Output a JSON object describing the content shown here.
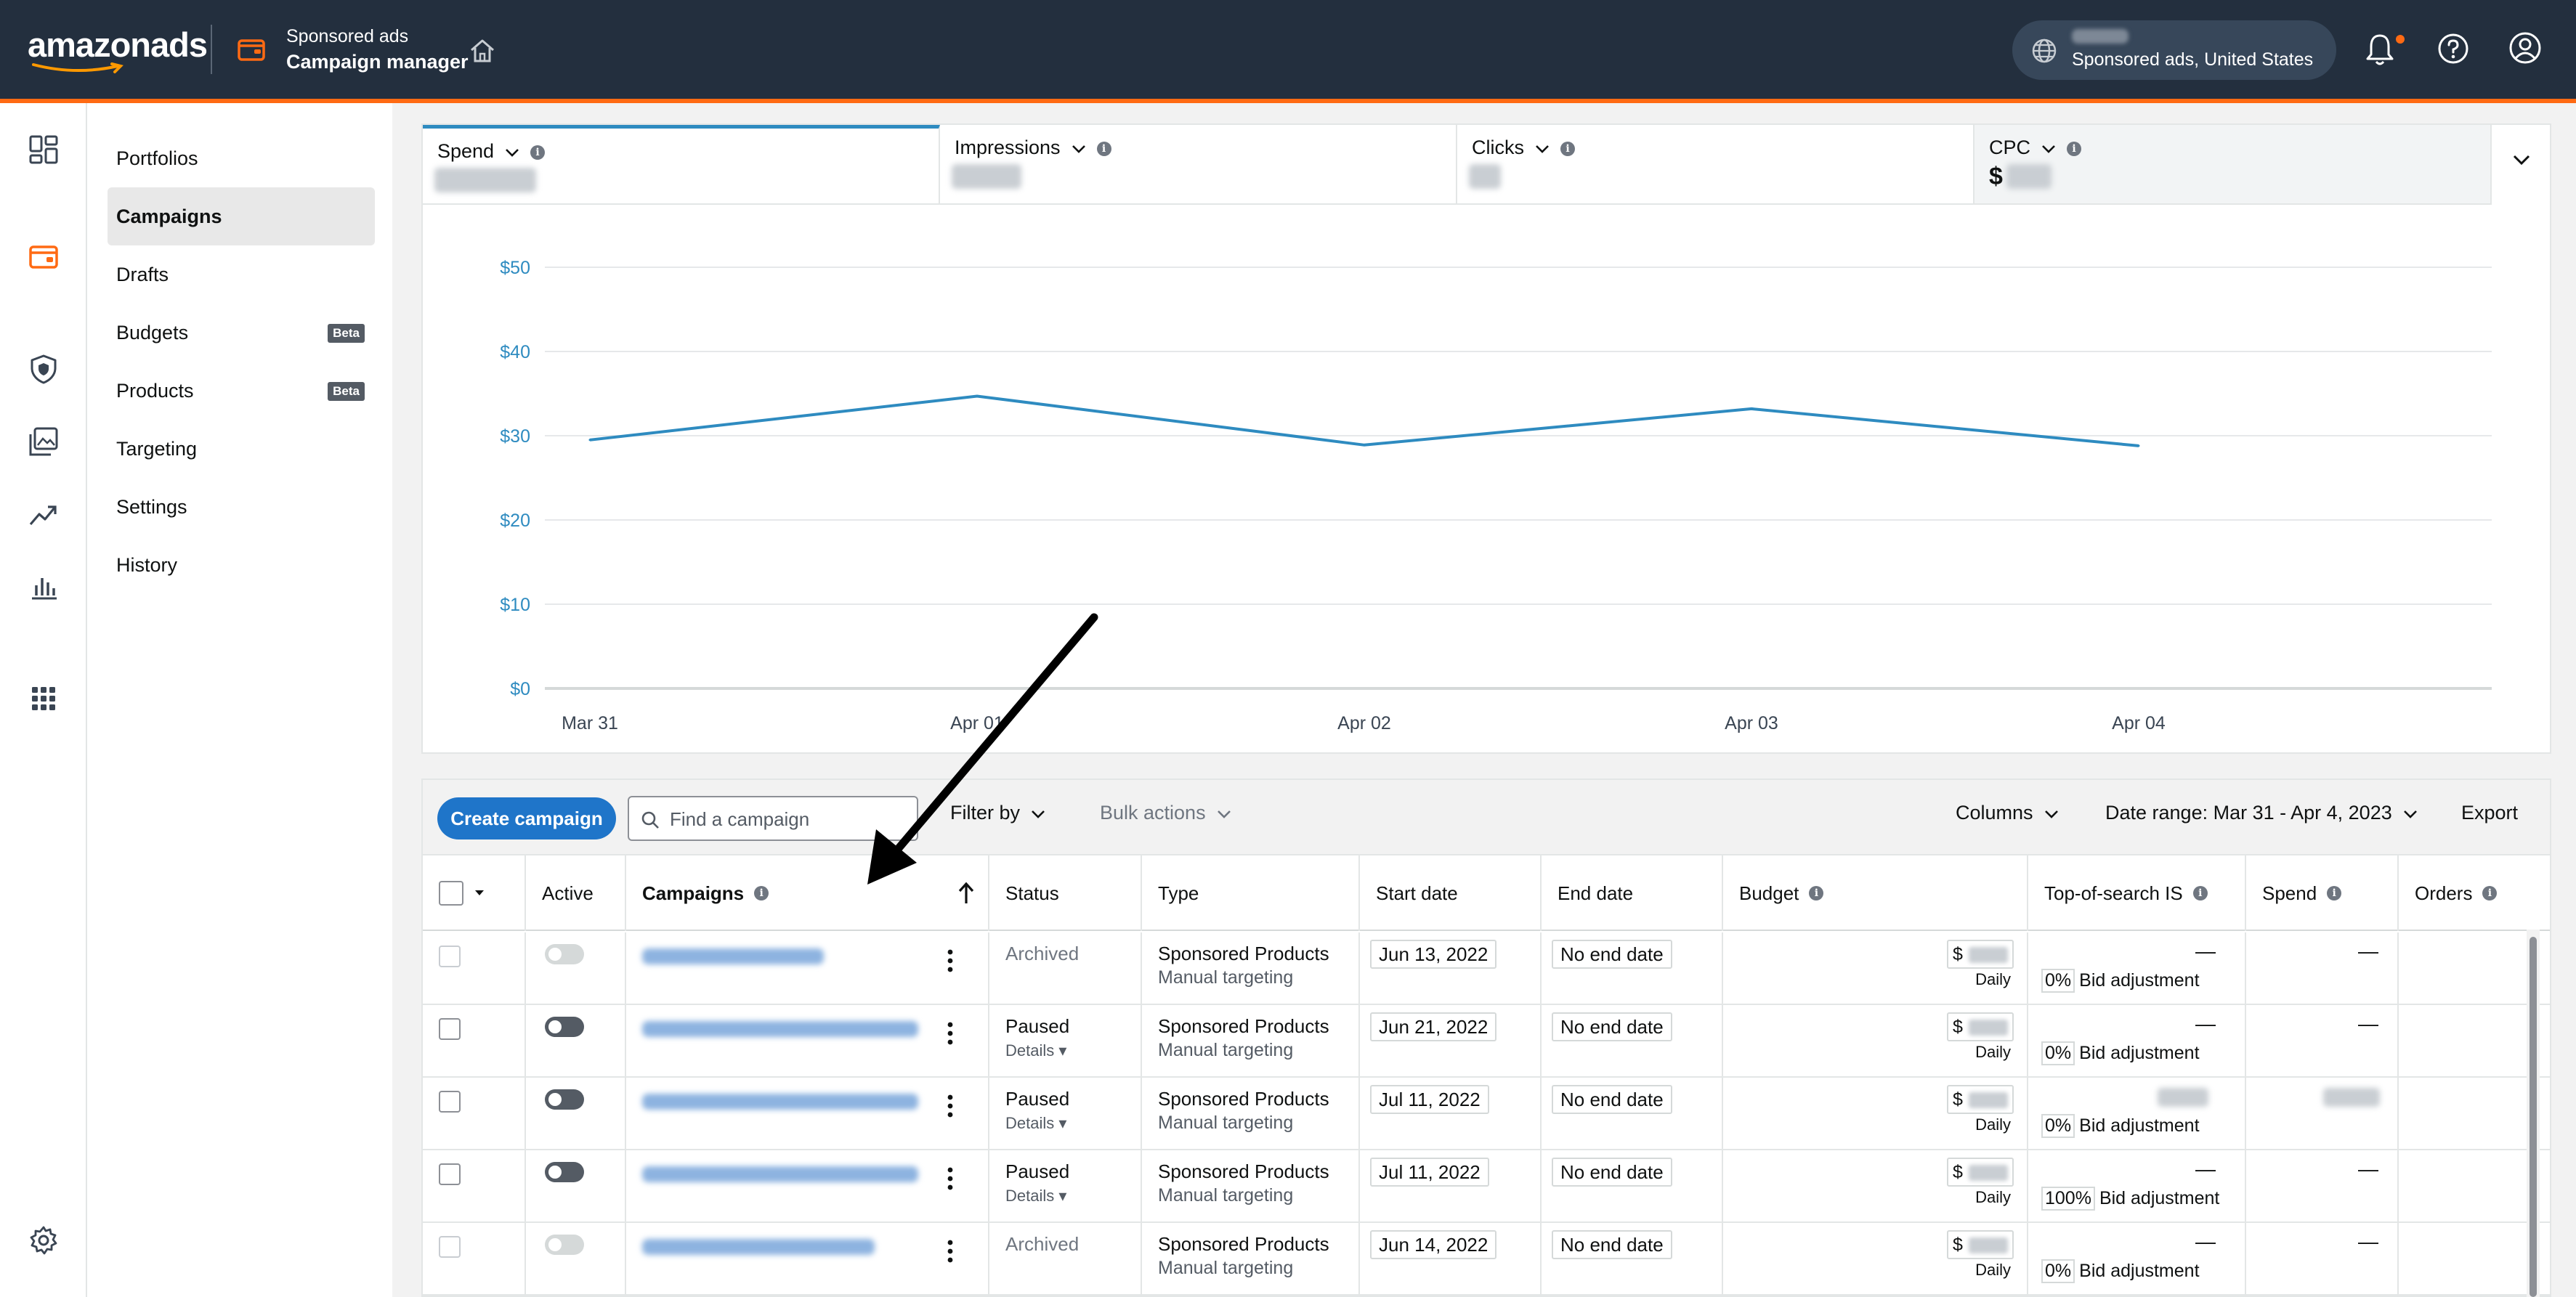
{
  "topbar": {
    "logo": "amazonads",
    "app_sub": "Sponsored ads",
    "app_main": "Campaign manager",
    "account_label": "Sponsored ads, United States"
  },
  "sidenav": {
    "items": [
      {
        "label": "Portfolios"
      },
      {
        "label": "Campaigns",
        "active": true
      },
      {
        "label": "Drafts"
      },
      {
        "label": "Budgets",
        "badge": "Beta"
      },
      {
        "label": "Products",
        "badge": "Beta"
      },
      {
        "label": "Targeting"
      },
      {
        "label": "Settings"
      },
      {
        "label": "History"
      }
    ]
  },
  "metrics": {
    "tabs": [
      {
        "label": "Spend"
      },
      {
        "label": "Impressions"
      },
      {
        "label": "Clicks"
      },
      {
        "label": "CPC",
        "prefix": "$"
      }
    ]
  },
  "chart_data": {
    "type": "line",
    "x": [
      "Mar 31",
      "Apr 01",
      "Apr 02",
      "Apr 03",
      "Apr 04"
    ],
    "series": [
      {
        "values": [
          29.5,
          34.7,
          28.9,
          33.2,
          28.8
        ]
      }
    ],
    "yticks": [
      "$0",
      "$10",
      "$20",
      "$30",
      "$40",
      "$50"
    ],
    "ylim": [
      0,
      50
    ],
    "grid": true,
    "color": "#2e8bc0"
  },
  "toolbar": {
    "create_label": "Create campaign",
    "search_placeholder": "Find a campaign",
    "filter_label": "Filter by",
    "bulk_label": "Bulk actions",
    "columns_label": "Columns",
    "date_range_label": "Date range: Mar 31 - Apr 4, 2023",
    "export_label": "Export"
  },
  "table": {
    "headers": {
      "active": "Active",
      "campaigns": "Campaigns",
      "status": "Status",
      "type": "Type",
      "start": "Start date",
      "end": "End date",
      "budget": "Budget",
      "tos": "Top-of-search IS",
      "spend": "Spend",
      "orders": "Orders"
    },
    "rows": [
      {
        "status": "Archived",
        "details": "",
        "type1": "Sponsored Products",
        "type2": "Manual targeting",
        "start": "Jun 13, 2022",
        "end": "No end date",
        "budget_prefix": "$",
        "budget_period": "Daily",
        "tos": "—",
        "bid_pct": "0%",
        "bid_label": "Bid adjustment",
        "spend": "—"
      },
      {
        "status": "Paused",
        "details": "Details",
        "type1": "Sponsored Products",
        "type2": "Manual targeting",
        "start": "Jun 21, 2022",
        "end": "No end date",
        "budget_prefix": "$",
        "budget_period": "Daily",
        "tos": "—",
        "bid_pct": "0%",
        "bid_label": "Bid adjustment",
        "spend": "—"
      },
      {
        "status": "Paused",
        "details": "Details",
        "type1": "Sponsored Products",
        "type2": "Manual targeting",
        "start": "Jul 11, 2022",
        "end": "No end date",
        "budget_prefix": "$",
        "budget_period": "Daily",
        "tos": "",
        "bid_pct": "0%",
        "bid_label": "Bid adjustment",
        "spend": ""
      },
      {
        "status": "Paused",
        "details": "Details",
        "type1": "Sponsored Products",
        "type2": "Manual targeting",
        "start": "Jul 11, 2022",
        "end": "No end date",
        "budget_prefix": "$",
        "budget_period": "Daily",
        "tos": "—",
        "bid_pct": "100%",
        "bid_label": "Bid adjustment",
        "spend": "—"
      },
      {
        "status": "Archived",
        "details": "",
        "type1": "Sponsored Products",
        "type2": "Manual targeting",
        "start": "Jun 14, 2022",
        "end": "No end date",
        "budget_prefix": "$",
        "budget_period": "Daily",
        "tos": "—",
        "bid_pct": "0%",
        "bid_label": "Bid adjustment",
        "spend": "—"
      }
    ]
  }
}
